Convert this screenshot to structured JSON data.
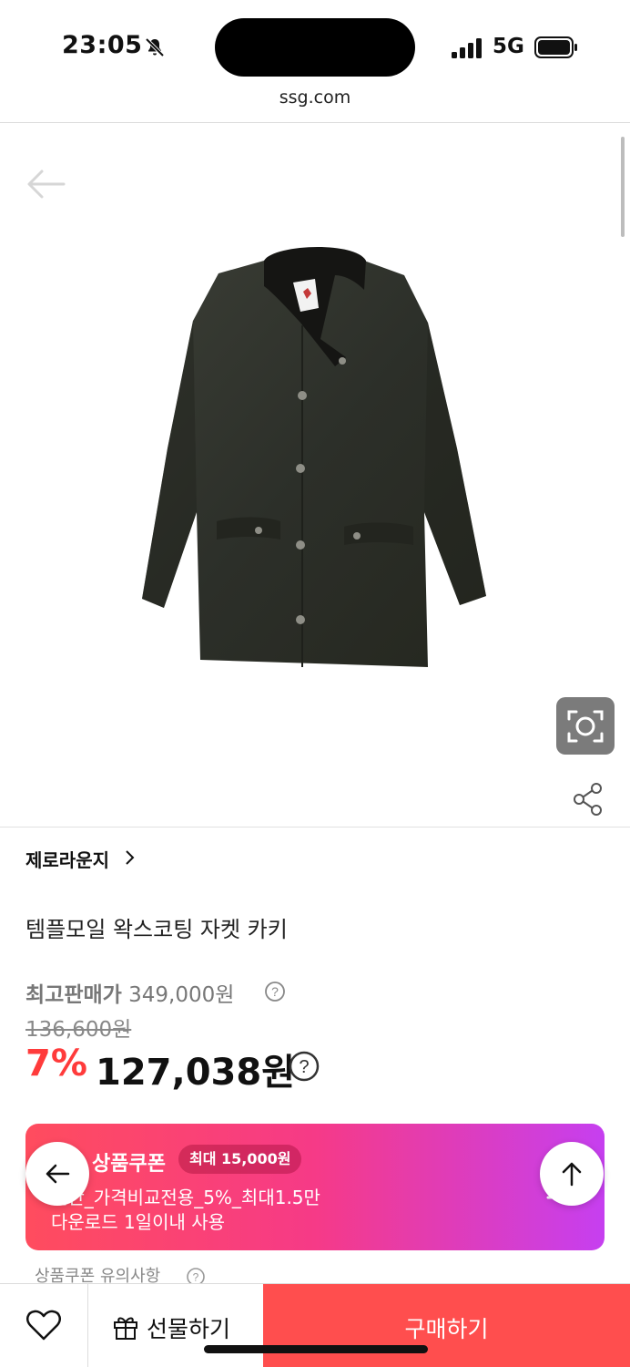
{
  "status_bar": {
    "time": "23:05",
    "network": "5G"
  },
  "browser": {
    "url": "ssg.com"
  },
  "product": {
    "brand": "제로라운지",
    "title": "템플모일 왁스코팅 자켓 카키",
    "max_price_label": "최고판매가",
    "max_price": "349,000원",
    "original_price": "136,600원",
    "discount_rate": "7%",
    "sale_price": "127,038원"
  },
  "coupon": {
    "title": "5% 상품쿠폰",
    "badge": "최대 15,000원",
    "description_line1": "일반_가격비교전용_5%_최대1.5만",
    "description_line2": "다운로드 1일이내 사용",
    "notice": "상품쿠폰 유의사항"
  },
  "actions": {
    "gift_label": "선물하기",
    "buy_label": "구매하기"
  },
  "icons": [
    "bell-slash-icon",
    "signal-icon",
    "battery-icon",
    "back-arrow-icon",
    "lens-icon",
    "share-icon",
    "chevron-right-icon",
    "help-icon",
    "download-icon",
    "arrow-up-icon",
    "heart-icon",
    "gift-icon"
  ],
  "colors": {
    "accent_red": "#ff4e4e",
    "discount_red": "#ff3b3b",
    "coupon_gradient_start": "#ff4c5e",
    "coupon_gradient_end": "#c63ff0"
  }
}
